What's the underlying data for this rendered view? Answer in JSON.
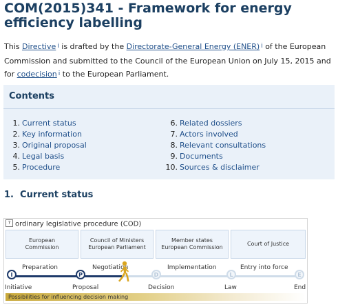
{
  "header": {
    "title": "COM(2015)341 - Framework for energy efficiency labelling"
  },
  "intro": {
    "t1": "This ",
    "directive": "Directive",
    "t2": " is drafted by the ",
    "dg": "Directorate-General Energy (ENER)",
    "t3": " of the European Commission and submitted to the Council of the European Union on July 15, 2015 and for ",
    "codecision": "codecision",
    "t4": " to the European Parliament.",
    "info_glyph": "i"
  },
  "contents": {
    "title": "Contents",
    "items": [
      {
        "num": "1.",
        "label": "Current status"
      },
      {
        "num": "2.",
        "label": "Key information"
      },
      {
        "num": "3.",
        "label": "Original proposal"
      },
      {
        "num": "4.",
        "label": "Legal basis"
      },
      {
        "num": "5.",
        "label": "Procedure"
      },
      {
        "num": "6.",
        "label": "Related dossiers"
      },
      {
        "num": "7.",
        "label": "Actors involved"
      },
      {
        "num": "8.",
        "label": "Relevant consultations"
      },
      {
        "num": "9.",
        "label": "Documents"
      },
      {
        "num": "10.",
        "label": "Sources & disclaimer"
      }
    ]
  },
  "current_status": {
    "heading": "1.  Current status"
  },
  "procedure": {
    "help_glyph": "?",
    "label": "ordinary legislative procedure (COD)",
    "institutions": [
      {
        "line1": "European",
        "line2": "Commission"
      },
      {
        "line1": "Council of Ministers",
        "line2": "European Parliament"
      },
      {
        "line1": "Member states",
        "line2": "European Commission"
      },
      {
        "line1": "Court of Justice",
        "line2": ""
      }
    ],
    "phases": [
      "Preparation",
      "Negotiation",
      "Implementation",
      "Entry into force"
    ],
    "nodes": [
      "I",
      "P",
      "D",
      "L",
      "E"
    ],
    "milestones": [
      "Initiative",
      "Proposal",
      "Decision",
      "Law",
      "End"
    ],
    "possibilities": "Possibilities for influencing decision making",
    "colors": {
      "done": "#1e3a6a",
      "todo": "#cfdce9",
      "walker": "#d9a520"
    }
  }
}
